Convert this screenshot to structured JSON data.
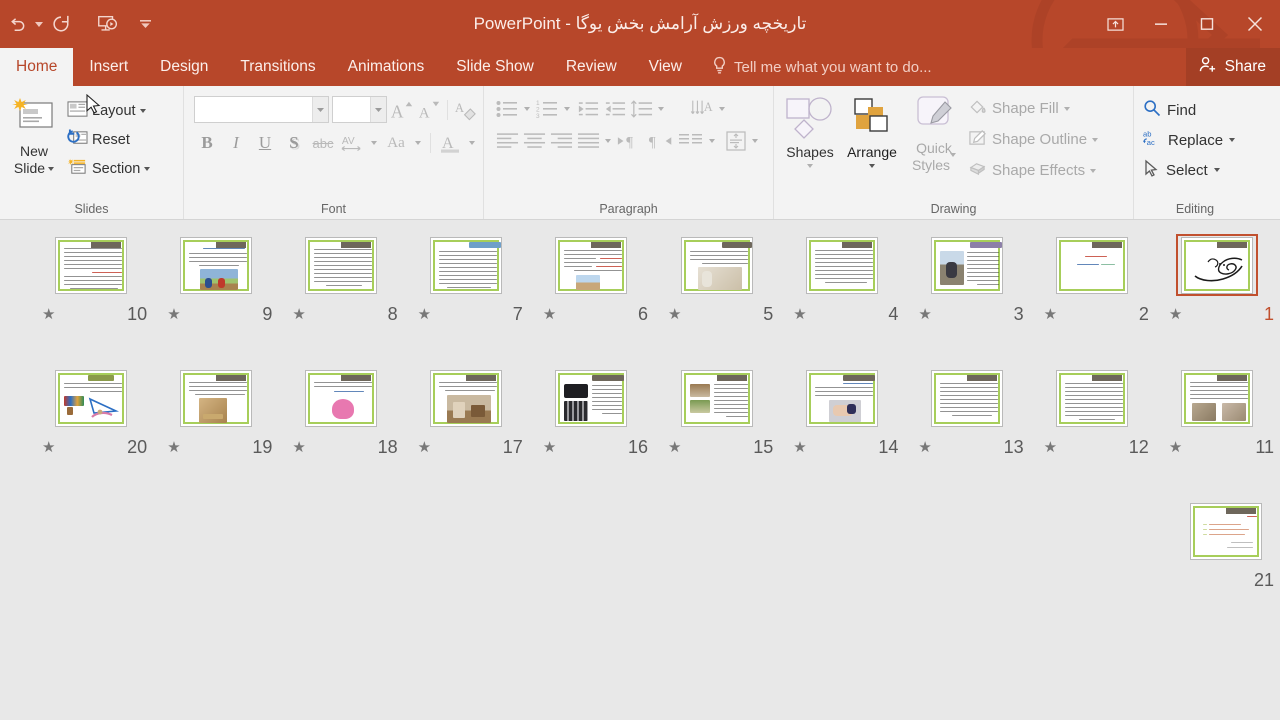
{
  "app": {
    "name": "PowerPoint",
    "document_title": "تاریخچه ورزش آرامش بخش یوگا",
    "title_full": "تاریخچه ورزش آرامش بخش یوگا - PowerPoint",
    "accent_color": "#B7472A",
    "ribbon_bg": "#F3F3F3",
    "workspace_bg": "#E8E8E8"
  },
  "quick_access": {
    "items": [
      {
        "name": "undo",
        "icon": "undo-icon",
        "label": "Undo"
      },
      {
        "name": "undo-dropdown",
        "icon": "chevron-down-icon",
        "label": ""
      },
      {
        "name": "redo",
        "icon": "redo-icon",
        "label": "Redo"
      },
      {
        "name": "start-from-beginning",
        "icon": "presentation-play-icon",
        "label": "Start From Beginning"
      },
      {
        "name": "customize-qat",
        "icon": "chevron-down-icon",
        "label": "Customize Quick Access Toolbar"
      }
    ]
  },
  "window_controls": {
    "ribbon_display": "Ribbon Display Options",
    "minimize": "Minimize",
    "restore": "Restore Down",
    "close": "Close"
  },
  "tabs": {
    "items": [
      {
        "label": "Home",
        "active": true
      },
      {
        "label": "Insert",
        "active": false
      },
      {
        "label": "Design",
        "active": false
      },
      {
        "label": "Transitions",
        "active": false
      },
      {
        "label": "Animations",
        "active": false
      },
      {
        "label": "Slide Show",
        "active": false
      },
      {
        "label": "Review",
        "active": false
      },
      {
        "label": "View",
        "active": false
      }
    ],
    "tell_me": "Tell me what you want to do...",
    "share": "Share"
  },
  "ribbon": {
    "groups": [
      {
        "title": "Slides"
      },
      {
        "title": "Font"
      },
      {
        "title": "Paragraph"
      },
      {
        "title": "Drawing"
      },
      {
        "title": "Editing"
      }
    ],
    "slides": {
      "new_slide_line1": "New",
      "new_slide_line2": "Slide",
      "layout": "Layout",
      "reset": "Reset",
      "section": "Section",
      "title": "Slides"
    },
    "font": {
      "font_name_value": "",
      "font_name_placeholder": "",
      "font_size_value": "",
      "font_size_placeholder": "",
      "increase_font": "A",
      "decrease_font": "A",
      "clear_formatting": "Clear All Formatting",
      "bold": "B",
      "italic": "I",
      "underline": "U",
      "shadow": "S",
      "strikethrough": "abc",
      "character_spacing": "AV",
      "change_case": "Aa",
      "font_color": "A",
      "title": "Font"
    },
    "paragraph": {
      "bullets": "Bullets",
      "numbering": "Numbering",
      "decrease_indent": "Decrease List Level",
      "increase_indent": "Increase List Level",
      "line_spacing": "Line Spacing",
      "align_left": "Align Left",
      "align_center": "Center",
      "align_right": "Align Right",
      "justify": "Justify",
      "ltr": "Left-to-Right Text Direction",
      "rtl": "Right-to-Left Text Direction",
      "columns": "Columns",
      "text_direction": "Text Direction",
      "align_text": "Align Text",
      "convert_smartart": "Convert to SmartArt",
      "title": "Paragraph"
    },
    "drawing": {
      "shapes": "Shapes",
      "arrange": "Arrange",
      "quick_styles_line1": "Quick",
      "quick_styles_line2": "Styles",
      "shape_fill": "Shape Fill",
      "shape_outline": "Shape Outline",
      "shape_effects": "Shape Effects",
      "title": "Drawing"
    },
    "editing": {
      "find": "Find",
      "replace": "Replace",
      "select": "Select",
      "title": "Editing"
    }
  },
  "slide_sorter": {
    "selected_slide": 1,
    "rows": [
      [
        {
          "number": "10",
          "star": true,
          "selected": false,
          "kind": "text-full"
        },
        {
          "number": "9",
          "star": true,
          "selected": false,
          "kind": "text-photo-people"
        },
        {
          "number": "8",
          "star": true,
          "selected": false,
          "kind": "text-full"
        },
        {
          "number": "7",
          "star": true,
          "selected": false,
          "kind": "text-full-blue-title"
        },
        {
          "number": "6",
          "star": true,
          "selected": false,
          "kind": "text-photo-small"
        },
        {
          "number": "5",
          "star": true,
          "selected": false,
          "kind": "text-photo-right"
        },
        {
          "number": "4",
          "star": true,
          "selected": false,
          "kind": "text-full"
        },
        {
          "number": "3",
          "star": true,
          "selected": false,
          "kind": "text-photo-left"
        },
        {
          "number": "2",
          "star": true,
          "selected": false,
          "kind": "title-only"
        },
        {
          "number": "1",
          "star": true,
          "selected": true,
          "kind": "calligraphy"
        }
      ],
      [
        {
          "number": "20",
          "star": true,
          "selected": false,
          "kind": "diagram-colorful"
        },
        {
          "number": "19",
          "star": true,
          "selected": false,
          "kind": "text-photo-object"
        },
        {
          "number": "18",
          "star": true,
          "selected": false,
          "kind": "text-photo-pink"
        },
        {
          "number": "17",
          "star": true,
          "selected": false,
          "kind": "text-photo-room"
        },
        {
          "number": "16",
          "star": true,
          "selected": false,
          "kind": "text-photo-dark"
        },
        {
          "number": "15",
          "star": true,
          "selected": false,
          "kind": "text-photo-multi"
        },
        {
          "number": "14",
          "star": true,
          "selected": false,
          "kind": "text-photo-hand"
        },
        {
          "number": "13",
          "star": true,
          "selected": false,
          "kind": "text-full"
        },
        {
          "number": "12",
          "star": true,
          "selected": false,
          "kind": "text-full"
        },
        {
          "number": "11",
          "star": true,
          "selected": false,
          "kind": "text-photo-pair"
        }
      ],
      [
        {
          "number": "21",
          "star": false,
          "selected": false,
          "kind": "bullets-orange"
        }
      ]
    ]
  }
}
